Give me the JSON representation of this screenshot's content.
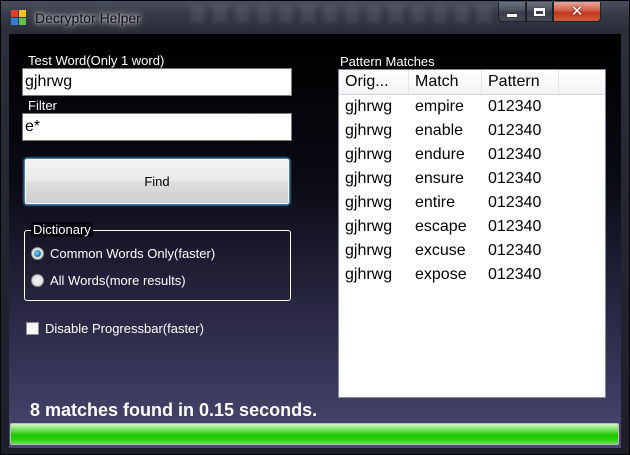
{
  "window": {
    "title": "Decryptor Helper",
    "close_glyph": "✕"
  },
  "form": {
    "test_word_label": "Test Word(Only 1 word)",
    "test_word_value": "gjhrwg",
    "filter_label": "Filter",
    "filter_value": "e*",
    "find_label": "Find"
  },
  "dictionary": {
    "legend": "Dictionary",
    "options": [
      {
        "label": "Common Words Only(faster)",
        "checked": true
      },
      {
        "label": "All Words(more results)",
        "checked": false
      }
    ]
  },
  "progress_option": {
    "label": "Disable Progressbar(faster)",
    "checked": false
  },
  "matches": {
    "label": "Pattern Matches",
    "columns": [
      "Orig...",
      "Match",
      "Pattern"
    ],
    "rows": [
      [
        "gjhrwg",
        "empire",
        "012340"
      ],
      [
        "gjhrwg",
        "enable",
        "012340"
      ],
      [
        "gjhrwg",
        "endure",
        "012340"
      ],
      [
        "gjhrwg",
        "ensure",
        "012340"
      ],
      [
        "gjhrwg",
        "entire",
        "012340"
      ],
      [
        "gjhrwg",
        "escape",
        "012340"
      ],
      [
        "gjhrwg",
        "excuse",
        "012340"
      ],
      [
        "gjhrwg",
        "expose",
        "012340"
      ]
    ]
  },
  "status": {
    "text": "8 matches found in 0.15 seconds.",
    "progress_percent": 100
  },
  "colors": {
    "accent_progress": "#1fc404",
    "close_button": "#c0391f",
    "radio_selected": "#1a7fc2"
  },
  "icons": {
    "app": "decryptor-app-icon",
    "minimize": "minimize-icon",
    "maximize": "maximize-icon",
    "close": "close-icon"
  }
}
